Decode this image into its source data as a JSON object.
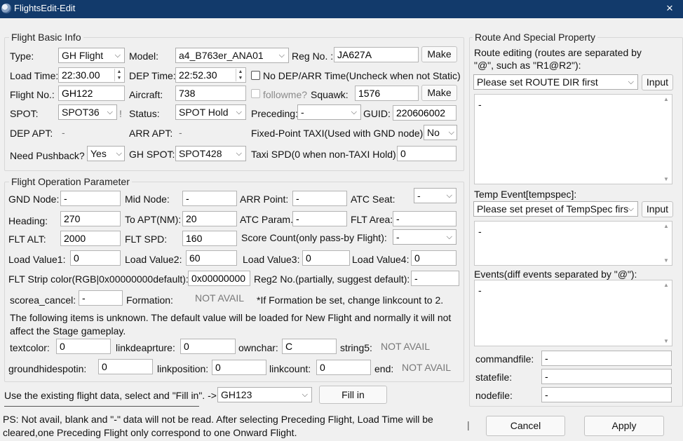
{
  "window": {
    "title": "FlightsEdit-Edit",
    "close": "×"
  },
  "basic": {
    "group": "Flight Basic Info",
    "type_label": "Type:",
    "type_value": "GH Flight",
    "model_label": "Model:",
    "model_value": "a4_B763er_ANA01",
    "reg_label": "Reg No. :",
    "reg_value": "JA627A",
    "make1": "Make",
    "loadtime_label": "Load Time:",
    "loadtime_value": "22:30.00",
    "deptime_label": "DEP Time:",
    "deptime_value": "22:52.30",
    "nodep_label": "No DEP/ARR Time(Uncheck when not Static)",
    "flightno_label": "Flight No.:",
    "flightno_value": "GH122",
    "aircraft_label": "Aircraft:",
    "aircraft_value": "738",
    "followme_label": "followme?",
    "squawk_label": "Squawk:",
    "squawk_value": "1576",
    "make2": "Make",
    "spot_label": "SPOT:",
    "spot_value": "SPOT36",
    "excl": "!",
    "status_label": "Status:",
    "status_value": "SPOT Hold",
    "preceding_label": "Preceding:",
    "preceding_value": "-",
    "guid_label": "GUID:",
    "guid_value": "220606002",
    "depapt_label": "DEP APT:",
    "depapt_value": "-",
    "arrapt_label": "ARR APT:",
    "arrapt_value": "-",
    "fixedtaxi_label": "Fixed-Point TAXI(Used with GND node)",
    "fixedtaxi_value": "No",
    "pushback_label": "Need Pushback?",
    "pushback_value": "Yes",
    "ghspot_label": "GH SPOT:",
    "ghspot_value": "SPOT428",
    "taxispd_label": "Taxi SPD(0 when non-TAXI Hold):",
    "taxispd_value": "0"
  },
  "op": {
    "group": "Flight Operation Parameter",
    "gnd_label": "GND Node:",
    "gnd_value": "-",
    "mid_label": "Mid Node:",
    "mid_value": "-",
    "arrpt_label": "ARR Point:",
    "arrpt_value": "-",
    "atcseat_label": "ATC Seat:",
    "atcseat_value": "-",
    "heading_label": "Heading:",
    "heading_value": "270",
    "toapt_label": "To APT(NM):",
    "toapt_value": "20",
    "atcparam_label": "ATC Param.:",
    "atcparam_value": "-",
    "fltarea_label": "FLT Area:",
    "fltarea_value": "-",
    "fltalt_label": "FLT ALT:",
    "fltalt_value": "2000",
    "fltspd_label": "FLT SPD:",
    "fltspd_value": "160",
    "score_label": "Score Count(only pass-by Flight):",
    "score_value": "-",
    "lv1_label": "Load Value1:",
    "lv1_value": "0",
    "lv2_label": "Load Value2:",
    "lv2_value": "60",
    "lv3_label": "Load Value3:",
    "lv3_value": "0",
    "lv4_label": "Load Value4:",
    "lv4_value": "0",
    "strip_label": "FLT Strip color(RGB|0x00000000default):",
    "strip_value": "0x00000000",
    "reg2_label": "Reg2 No.(partially, suggest default):",
    "reg2_value": "-",
    "scorea_label": "scorea_cancel:",
    "scorea_value": "-",
    "formation_label": "Formation:",
    "formation_value": "NOT AVAIL",
    "formation_note": "*If Formation be set, change linkcount to 2.",
    "unknown_line1": "The following items is unknown. The default value will be loaded for New Flight and normally it will not",
    "unknown_line2": "affect the Stage gameplay.",
    "textcolor_label": "textcolor:",
    "textcolor_value": "0",
    "linkdep_label": "linkdeaprture:",
    "linkdep_value": "0",
    "ownchar_label": "ownchar:",
    "ownchar_value": "C",
    "string5_label": "string5:",
    "string5_value": "NOT AVAIL",
    "ghide_label": "groundhidespotin:",
    "ghide_value": "0",
    "linkpos_label": "linkposition:",
    "linkpos_value": "0",
    "linkcount_label": "linkcount:",
    "linkcount_value": "0",
    "end_label": "end:",
    "end_value": "NOT AVAIL"
  },
  "fill": {
    "label": "Use the existing flight data, select and \"Fill in\". ->",
    "value": "GH123",
    "button": "Fill in"
  },
  "ps": {
    "line1": "PS: Not avail, blank and \"-\" data will not be read. After selecting Preceding Flight, Load Time will be",
    "line2": "cleared,one Preceding Flight only correspond to one Onward Flight."
  },
  "route": {
    "group": "Route And Special Property",
    "editing_line1": "Route editing (routes are separated by",
    "editing_line2": "\"@\", such as \"R1@R2\"):",
    "dir_value": "Please set ROUTE DIR first",
    "input1": "Input",
    "route_text": "-",
    "temp_label": "Temp Event[tempspec]:",
    "temp_value": "Please set preset of TempSpec firs",
    "input2": "Input",
    "temp_text": "-",
    "events_label": "Events(diff events separated by \"@\"):",
    "events_text": "-",
    "commandfile_label": "commandfile:",
    "commandfile_value": "-",
    "statefile_label": "statefile:",
    "statefile_value": "-",
    "nodefile_label": "nodefile:",
    "nodefile_value": "-"
  },
  "footer": {
    "sep": "|",
    "cancel": "Cancel",
    "apply": "Apply"
  }
}
